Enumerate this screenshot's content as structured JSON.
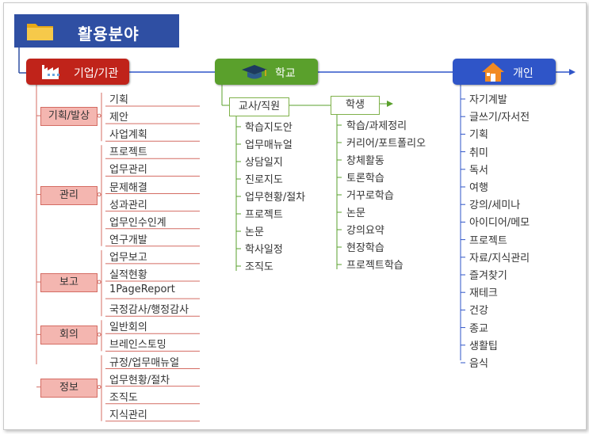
{
  "title": "활용분야",
  "colors": {
    "title_bg": "#2f4fa3",
    "corp": "#c0231a",
    "school": "#5aa02c",
    "personal": "#2f55c8",
    "category_fill": "#f4b6b0"
  },
  "nodes": {
    "corp": {
      "label": "기업/기관",
      "icon": "factory-icon"
    },
    "school": {
      "label": "학교",
      "icon": "graduation-cap-icon"
    },
    "personal": {
      "label": "개인",
      "icon": "house-icon"
    }
  },
  "corp_categories": [
    {
      "label": "기획/발상",
      "items": [
        "기획",
        "제안",
        "사업계획"
      ]
    },
    {
      "label": "관리",
      "items": [
        "프로젝트",
        "업무관리",
        "문제해결",
        "성과관리",
        "업무인수인계",
        "연구개발"
      ]
    },
    {
      "label": "보고",
      "items": [
        "업무보고",
        "실적현황",
        "1PageReport",
        "국정감사/행정감사"
      ]
    },
    {
      "label": "회의",
      "items": [
        "일반회의",
        "브레인스토밍"
      ]
    },
    {
      "label": "정보",
      "items": [
        "규정/업무매뉴얼",
        "업무현황/절차",
        "조직도",
        "지식관리"
      ]
    }
  ],
  "school_teacher": {
    "label": "교사/직원",
    "items": [
      "학습지도안",
      "업무매뉴얼",
      "상담일지",
      "진로지도",
      "업무현황/절차",
      "프로젝트",
      "논문",
      "학사일정",
      "조직도"
    ]
  },
  "school_student": {
    "label": "학생",
    "items": [
      "학습/과제정리",
      "커리어/포트폴리오",
      "창체활동",
      "토론학습",
      "거꾸로학습",
      "논문",
      "강의요약",
      "현장학습",
      "프로젝트학습"
    ]
  },
  "personal_items": [
    "자기계발",
    "글쓰기/자서전",
    "기획",
    "취미",
    "독서",
    "여행",
    "강의/세미나",
    "아이디어/메모",
    "프로젝트",
    "자료/지식관리",
    "즐겨찾기",
    "재테크",
    "건강",
    "종교",
    "생활팁",
    "음식"
  ]
}
